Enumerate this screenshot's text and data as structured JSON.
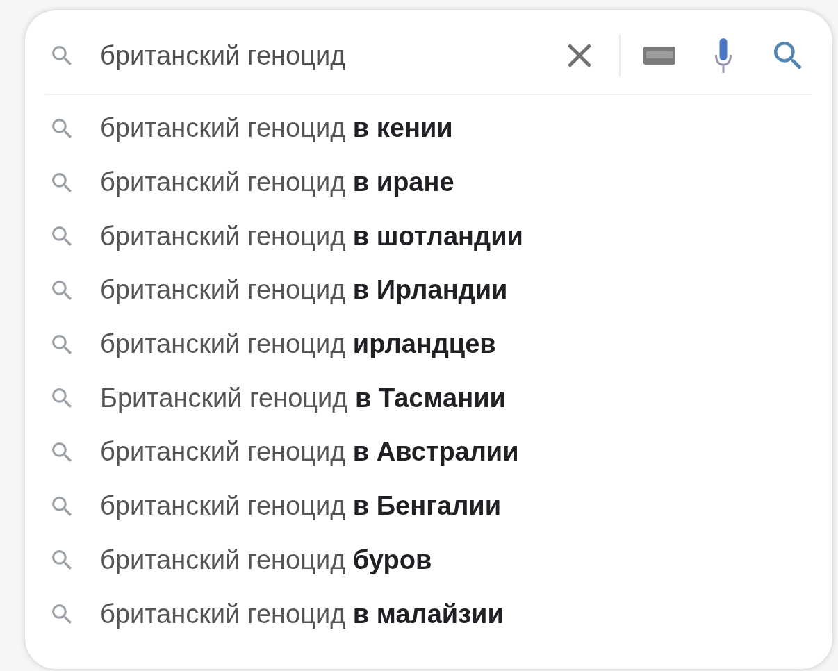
{
  "search_box": {
    "value": "британский геноцид"
  },
  "suggestions": [
    "британский геноцид **в кении**",
    "британский геноцид **в иране**",
    "британский геноцид **в шотландии**",
    "британский геноцид **в Ирландии**",
    "британский геноцид **ирландцев**",
    "Британский геноцид **в Тасмании**",
    "британский геноцид **в Австралии**",
    "британский геноцид **в Бенгалии**",
    "британский геноцид **буров**",
    "британский геноцид **в малайзии**"
  ]
}
